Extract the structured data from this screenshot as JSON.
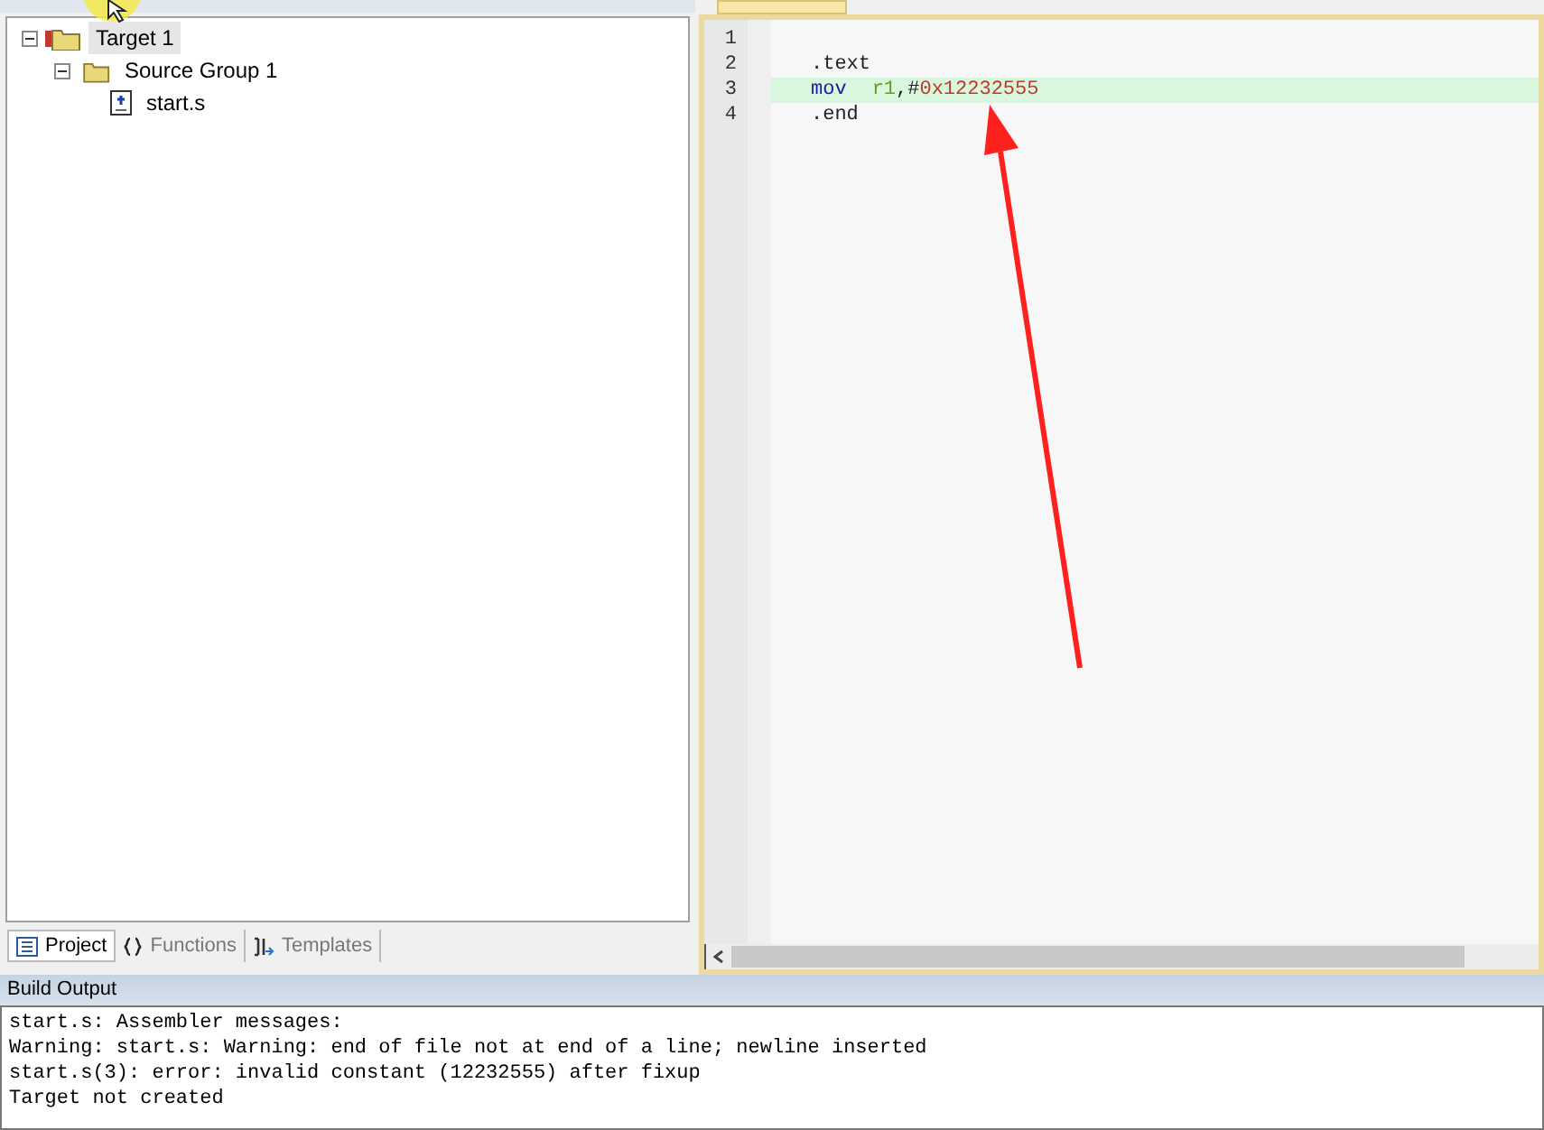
{
  "project_tree": [
    {
      "label": "Target 1",
      "kind": "target",
      "selected": true,
      "expanded": true,
      "children": [
        {
          "label": "Source Group 1",
          "kind": "group",
          "selected": false,
          "expanded": true,
          "children": [
            {
              "label": "start.s",
              "kind": "file",
              "selected": false
            }
          ]
        }
      ]
    }
  ],
  "panel_tabs": [
    {
      "label": "Project",
      "kind": "project",
      "selected": true
    },
    {
      "label": "Functions",
      "kind": "functions",
      "selected": false
    },
    {
      "label": "Templates",
      "kind": "templates",
      "selected": false
    }
  ],
  "editor": {
    "lines": [
      {
        "number": "1",
        "current": false
      },
      {
        "number": "2",
        "current": false,
        "tokens": [
          {
            "text": ".text",
            "kind": "directive"
          }
        ]
      },
      {
        "number": "3",
        "current": true,
        "tokens": [
          {
            "text": "mov",
            "kind": "keyword"
          },
          {
            "text": "r1",
            "kind": "register"
          },
          {
            "text": ",#",
            "kind": "plain"
          },
          {
            "text": "0x12232555",
            "kind": "number"
          }
        ]
      },
      {
        "number": "4",
        "current": false,
        "tokens": [
          {
            "text": ".end",
            "kind": "directive"
          }
        ]
      }
    ]
  },
  "build_output": {
    "title": "Build Output",
    "lines": [
      "start.s: Assembler messages:",
      "Warning: start.s: Warning: end of file not at end of a line; newline inserted",
      "start.s(3): error: invalid constant (12232555) after fixup",
      "Target not created"
    ]
  }
}
